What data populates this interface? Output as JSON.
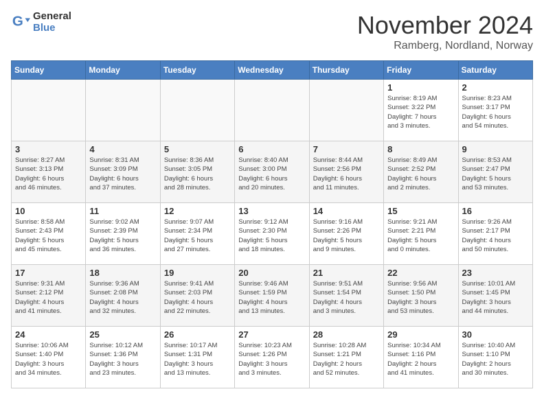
{
  "header": {
    "logo_line1": "General",
    "logo_line2": "Blue",
    "month": "November 2024",
    "location": "Ramberg, Nordland, Norway"
  },
  "weekdays": [
    "Sunday",
    "Monday",
    "Tuesday",
    "Wednesday",
    "Thursday",
    "Friday",
    "Saturday"
  ],
  "weeks": [
    [
      {
        "day": "",
        "info": ""
      },
      {
        "day": "",
        "info": ""
      },
      {
        "day": "",
        "info": ""
      },
      {
        "day": "",
        "info": ""
      },
      {
        "day": "",
        "info": ""
      },
      {
        "day": "1",
        "info": "Sunrise: 8:19 AM\nSunset: 3:22 PM\nDaylight: 7 hours\nand 3 minutes."
      },
      {
        "day": "2",
        "info": "Sunrise: 8:23 AM\nSunset: 3:17 PM\nDaylight: 6 hours\nand 54 minutes."
      }
    ],
    [
      {
        "day": "3",
        "info": "Sunrise: 8:27 AM\nSunset: 3:13 PM\nDaylight: 6 hours\nand 46 minutes."
      },
      {
        "day": "4",
        "info": "Sunrise: 8:31 AM\nSunset: 3:09 PM\nDaylight: 6 hours\nand 37 minutes."
      },
      {
        "day": "5",
        "info": "Sunrise: 8:36 AM\nSunset: 3:05 PM\nDaylight: 6 hours\nand 28 minutes."
      },
      {
        "day": "6",
        "info": "Sunrise: 8:40 AM\nSunset: 3:00 PM\nDaylight: 6 hours\nand 20 minutes."
      },
      {
        "day": "7",
        "info": "Sunrise: 8:44 AM\nSunset: 2:56 PM\nDaylight: 6 hours\nand 11 minutes."
      },
      {
        "day": "8",
        "info": "Sunrise: 8:49 AM\nSunset: 2:52 PM\nDaylight: 6 hours\nand 2 minutes."
      },
      {
        "day": "9",
        "info": "Sunrise: 8:53 AM\nSunset: 2:47 PM\nDaylight: 5 hours\nand 53 minutes."
      }
    ],
    [
      {
        "day": "10",
        "info": "Sunrise: 8:58 AM\nSunset: 2:43 PM\nDaylight: 5 hours\nand 45 minutes."
      },
      {
        "day": "11",
        "info": "Sunrise: 9:02 AM\nSunset: 2:39 PM\nDaylight: 5 hours\nand 36 minutes."
      },
      {
        "day": "12",
        "info": "Sunrise: 9:07 AM\nSunset: 2:34 PM\nDaylight: 5 hours\nand 27 minutes."
      },
      {
        "day": "13",
        "info": "Sunrise: 9:12 AM\nSunset: 2:30 PM\nDaylight: 5 hours\nand 18 minutes."
      },
      {
        "day": "14",
        "info": "Sunrise: 9:16 AM\nSunset: 2:26 PM\nDaylight: 5 hours\nand 9 minutes."
      },
      {
        "day": "15",
        "info": "Sunrise: 9:21 AM\nSunset: 2:21 PM\nDaylight: 5 hours\nand 0 minutes."
      },
      {
        "day": "16",
        "info": "Sunrise: 9:26 AM\nSunset: 2:17 PM\nDaylight: 4 hours\nand 50 minutes."
      }
    ],
    [
      {
        "day": "17",
        "info": "Sunrise: 9:31 AM\nSunset: 2:12 PM\nDaylight: 4 hours\nand 41 minutes."
      },
      {
        "day": "18",
        "info": "Sunrise: 9:36 AM\nSunset: 2:08 PM\nDaylight: 4 hours\nand 32 minutes."
      },
      {
        "day": "19",
        "info": "Sunrise: 9:41 AM\nSunset: 2:03 PM\nDaylight: 4 hours\nand 22 minutes."
      },
      {
        "day": "20",
        "info": "Sunrise: 9:46 AM\nSunset: 1:59 PM\nDaylight: 4 hours\nand 13 minutes."
      },
      {
        "day": "21",
        "info": "Sunrise: 9:51 AM\nSunset: 1:54 PM\nDaylight: 4 hours\nand 3 minutes."
      },
      {
        "day": "22",
        "info": "Sunrise: 9:56 AM\nSunset: 1:50 PM\nDaylight: 3 hours\nand 53 minutes."
      },
      {
        "day": "23",
        "info": "Sunrise: 10:01 AM\nSunset: 1:45 PM\nDaylight: 3 hours\nand 44 minutes."
      }
    ],
    [
      {
        "day": "24",
        "info": "Sunrise: 10:06 AM\nSunset: 1:40 PM\nDaylight: 3 hours\nand 34 minutes."
      },
      {
        "day": "25",
        "info": "Sunrise: 10:12 AM\nSunset: 1:36 PM\nDaylight: 3 hours\nand 23 minutes."
      },
      {
        "day": "26",
        "info": "Sunrise: 10:17 AM\nSunset: 1:31 PM\nDaylight: 3 hours\nand 13 minutes."
      },
      {
        "day": "27",
        "info": "Sunrise: 10:23 AM\nSunset: 1:26 PM\nDaylight: 3 hours\nand 3 minutes."
      },
      {
        "day": "28",
        "info": "Sunrise: 10:28 AM\nSunset: 1:21 PM\nDaylight: 2 hours\nand 52 minutes."
      },
      {
        "day": "29",
        "info": "Sunrise: 10:34 AM\nSunset: 1:16 PM\nDaylight: 2 hours\nand 41 minutes."
      },
      {
        "day": "30",
        "info": "Sunrise: 10:40 AM\nSunset: 1:10 PM\nDaylight: 2 hours\nand 30 minutes."
      }
    ]
  ]
}
